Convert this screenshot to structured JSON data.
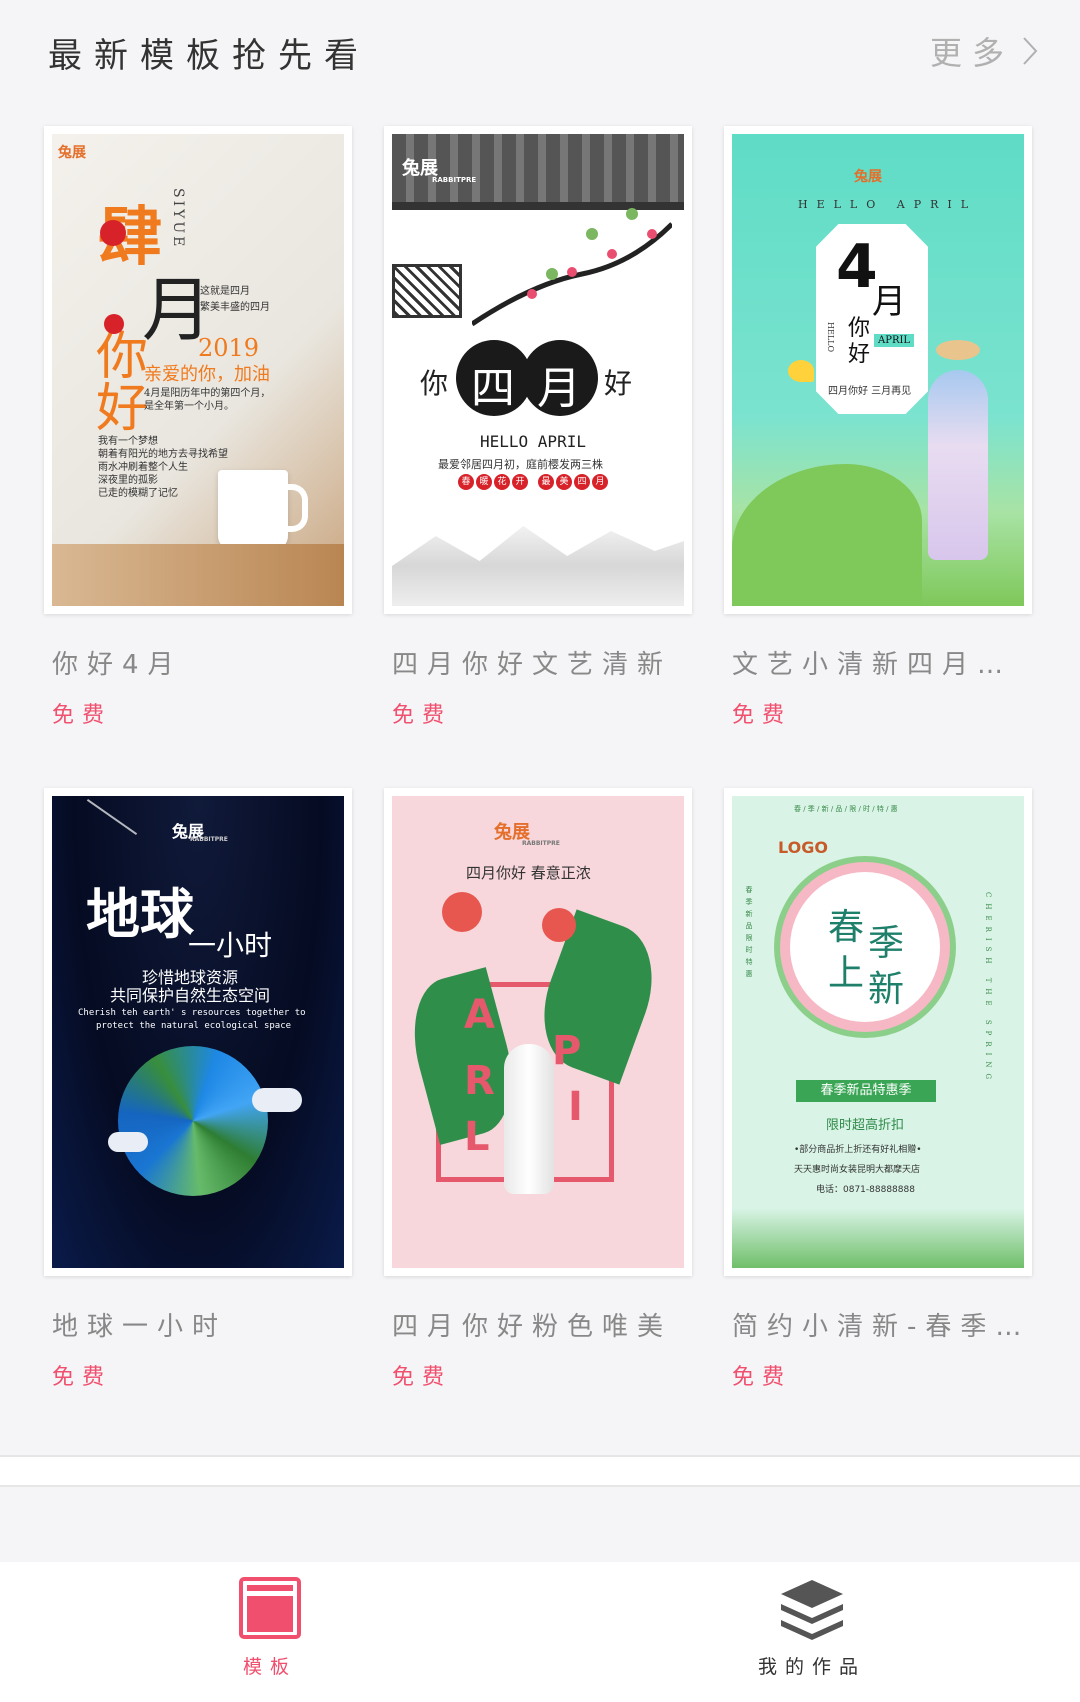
{
  "header": {
    "title": "最新模板抢先看",
    "more_label": "更多"
  },
  "templates": [
    {
      "title": "你好4月",
      "price": "免费",
      "poster": {
        "logo": "兔展",
        "big1": "肆",
        "big2": "月",
        "big3": "你",
        "big4": "好",
        "side": "SIYUE",
        "year": "2019",
        "line1": "这就是四月",
        "line2": "繁美丰盛的四月",
        "slogan": "亲爱的你，加油",
        "desc1": "4月是阳历年中的第四个月，",
        "desc2": "是全年第一个小月。",
        "p1": "我有一个梦想",
        "p2": "朝着有阳光的地方去寻找希望",
        "p3": "雨水冲刷着整个人生",
        "p4": "深夜里的孤影",
        "p5": "已走的模糊了记忆"
      }
    },
    {
      "title": "四月你好文艺清新",
      "price": "免费",
      "poster": {
        "logo": "兔展",
        "logo_sub": "RABBITPRE",
        "left": "你",
        "c1": "四",
        "c2": "月",
        "right": "好",
        "en": "HELLO APRIL",
        "desc": "最爱邻居四月初，庭前樱发两三株",
        "tags": [
          "春",
          "暖",
          "花",
          "开",
          "最",
          "美",
          "四",
          "月"
        ]
      }
    },
    {
      "title": "文艺小清新四月你好",
      "price": "免费",
      "poster": {
        "logo": "兔展",
        "en": "HELLO APRIL",
        "num": "4",
        "month": "月",
        "you": "你",
        "hao": "好",
        "badge": "APRIL",
        "side": "HELLO",
        "sub": "四月你好 三月再见"
      }
    },
    {
      "title": "地球一小时",
      "price": "免费",
      "poster": {
        "logo": "兔展",
        "logo_sub": "RABBITPRE",
        "t1": "地球",
        "t2": "一小时",
        "s1": "珍惜地球资源",
        "s2": "共同保护自然生态空间",
        "e1": "Cherish teh earth' s resources together to",
        "e2": "protect the natural ecological space"
      }
    },
    {
      "title": "四月你好粉色唯美",
      "price": "免费",
      "poster": {
        "logo": "兔展",
        "logo_sub": "RABBITPRE",
        "sub": "四月你好  春意正浓",
        "letters": [
          "A",
          "P",
          "R",
          "I",
          "L"
        ]
      }
    },
    {
      "title": "简约小清新-春季上新",
      "price": "免费",
      "poster": {
        "logo": "LOGO",
        "top": "春 / 季 / 新 / 品 / 限 / 时 / 特 / 惠",
        "c1": "春",
        "c2": "季",
        "c3": "上",
        "c4": "新",
        "ribbon": "春季新品特惠季",
        "line": "限时超高折扣",
        "d1": "•部分商品折上折还有好礼相赠•",
        "d2": "天天惠时尚女装昆明大都摩天店",
        "d3": "电话：0871-88888888",
        "side_r": "CHERISH THE SPRING",
        "side_l": "春季新品限时特惠"
      }
    }
  ],
  "tabbar": {
    "tabs": [
      {
        "label": "模板",
        "icon": "template-icon",
        "active": true
      },
      {
        "label": "我的作品",
        "icon": "layers-icon",
        "active": false
      }
    ]
  },
  "colors": {
    "accent": "#f0506e",
    "tab_active": "#f0506e",
    "tab_inactive": "#333333"
  }
}
